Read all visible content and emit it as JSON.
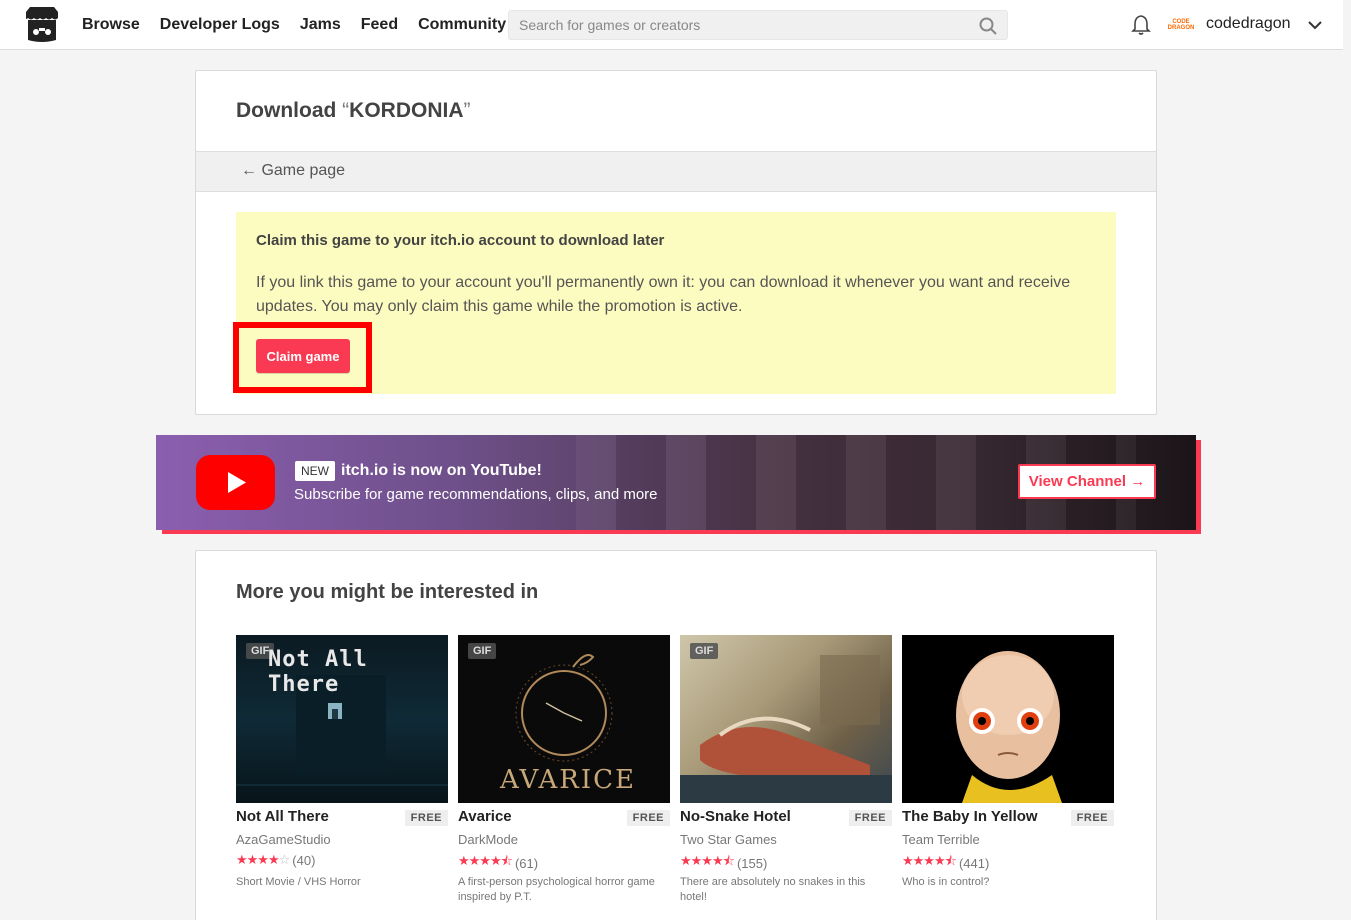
{
  "header": {
    "nav": [
      "Browse",
      "Developer Logs",
      "Jams",
      "Feed",
      "Community"
    ],
    "search_placeholder": "Search for games or creators",
    "username": "codedragon",
    "avatar_text": "CODE DRAGON"
  },
  "download": {
    "title_prefix": "Download ",
    "open_quote": "“",
    "game_name": "KORDONIA",
    "close_quote": "”",
    "back_label": "← Game page",
    "claim_title": "Claim this game to your itch.io account to download later",
    "claim_text": "If you link this game to your account you'll permanently own it: you can download it whenever you want and receive updates. You may only claim this game while the promotion is active.",
    "claim_button": "Claim game"
  },
  "banner": {
    "badge": "NEW",
    "title": "itch.io is now on YouTube!",
    "subtitle": "Subscribe for game recommendations, clips, and more",
    "button": "View Channel →"
  },
  "recommendations": {
    "heading": "More you might be interested in",
    "games": [
      {
        "title": "Not All There",
        "price": "FREE",
        "author": "AzaGameStudio",
        "rating": 4,
        "count": "(40)",
        "desc": "Short Movie / VHS Horror",
        "gif": "GIF",
        "thumb_text": "Not All There"
      },
      {
        "title": "Avarice",
        "price": "FREE",
        "author": "DarkMode",
        "rating": 4.5,
        "count": "(61)",
        "desc": "A first-person psychological horror game inspired by P.T.",
        "gif": "GIF",
        "thumb_text": "AVARICE"
      },
      {
        "title": "No-Snake Hotel",
        "price": "FREE",
        "author": "Two Star Games",
        "rating": 4.5,
        "count": "(155)",
        "desc": "There are absolutely no snakes in this hotel!",
        "gif": "GIF",
        "thumb_text": ""
      },
      {
        "title": "The Baby In Yellow",
        "price": "FREE",
        "author": "Team Terrible",
        "rating": 4.5,
        "count": "(441)",
        "desc": "Who is in control?",
        "gif": "",
        "thumb_text": ""
      }
    ]
  },
  "colors": {
    "accent": "#fa3a52",
    "claim_bg": "#fdfcc0",
    "highlight": "#ff0000"
  }
}
